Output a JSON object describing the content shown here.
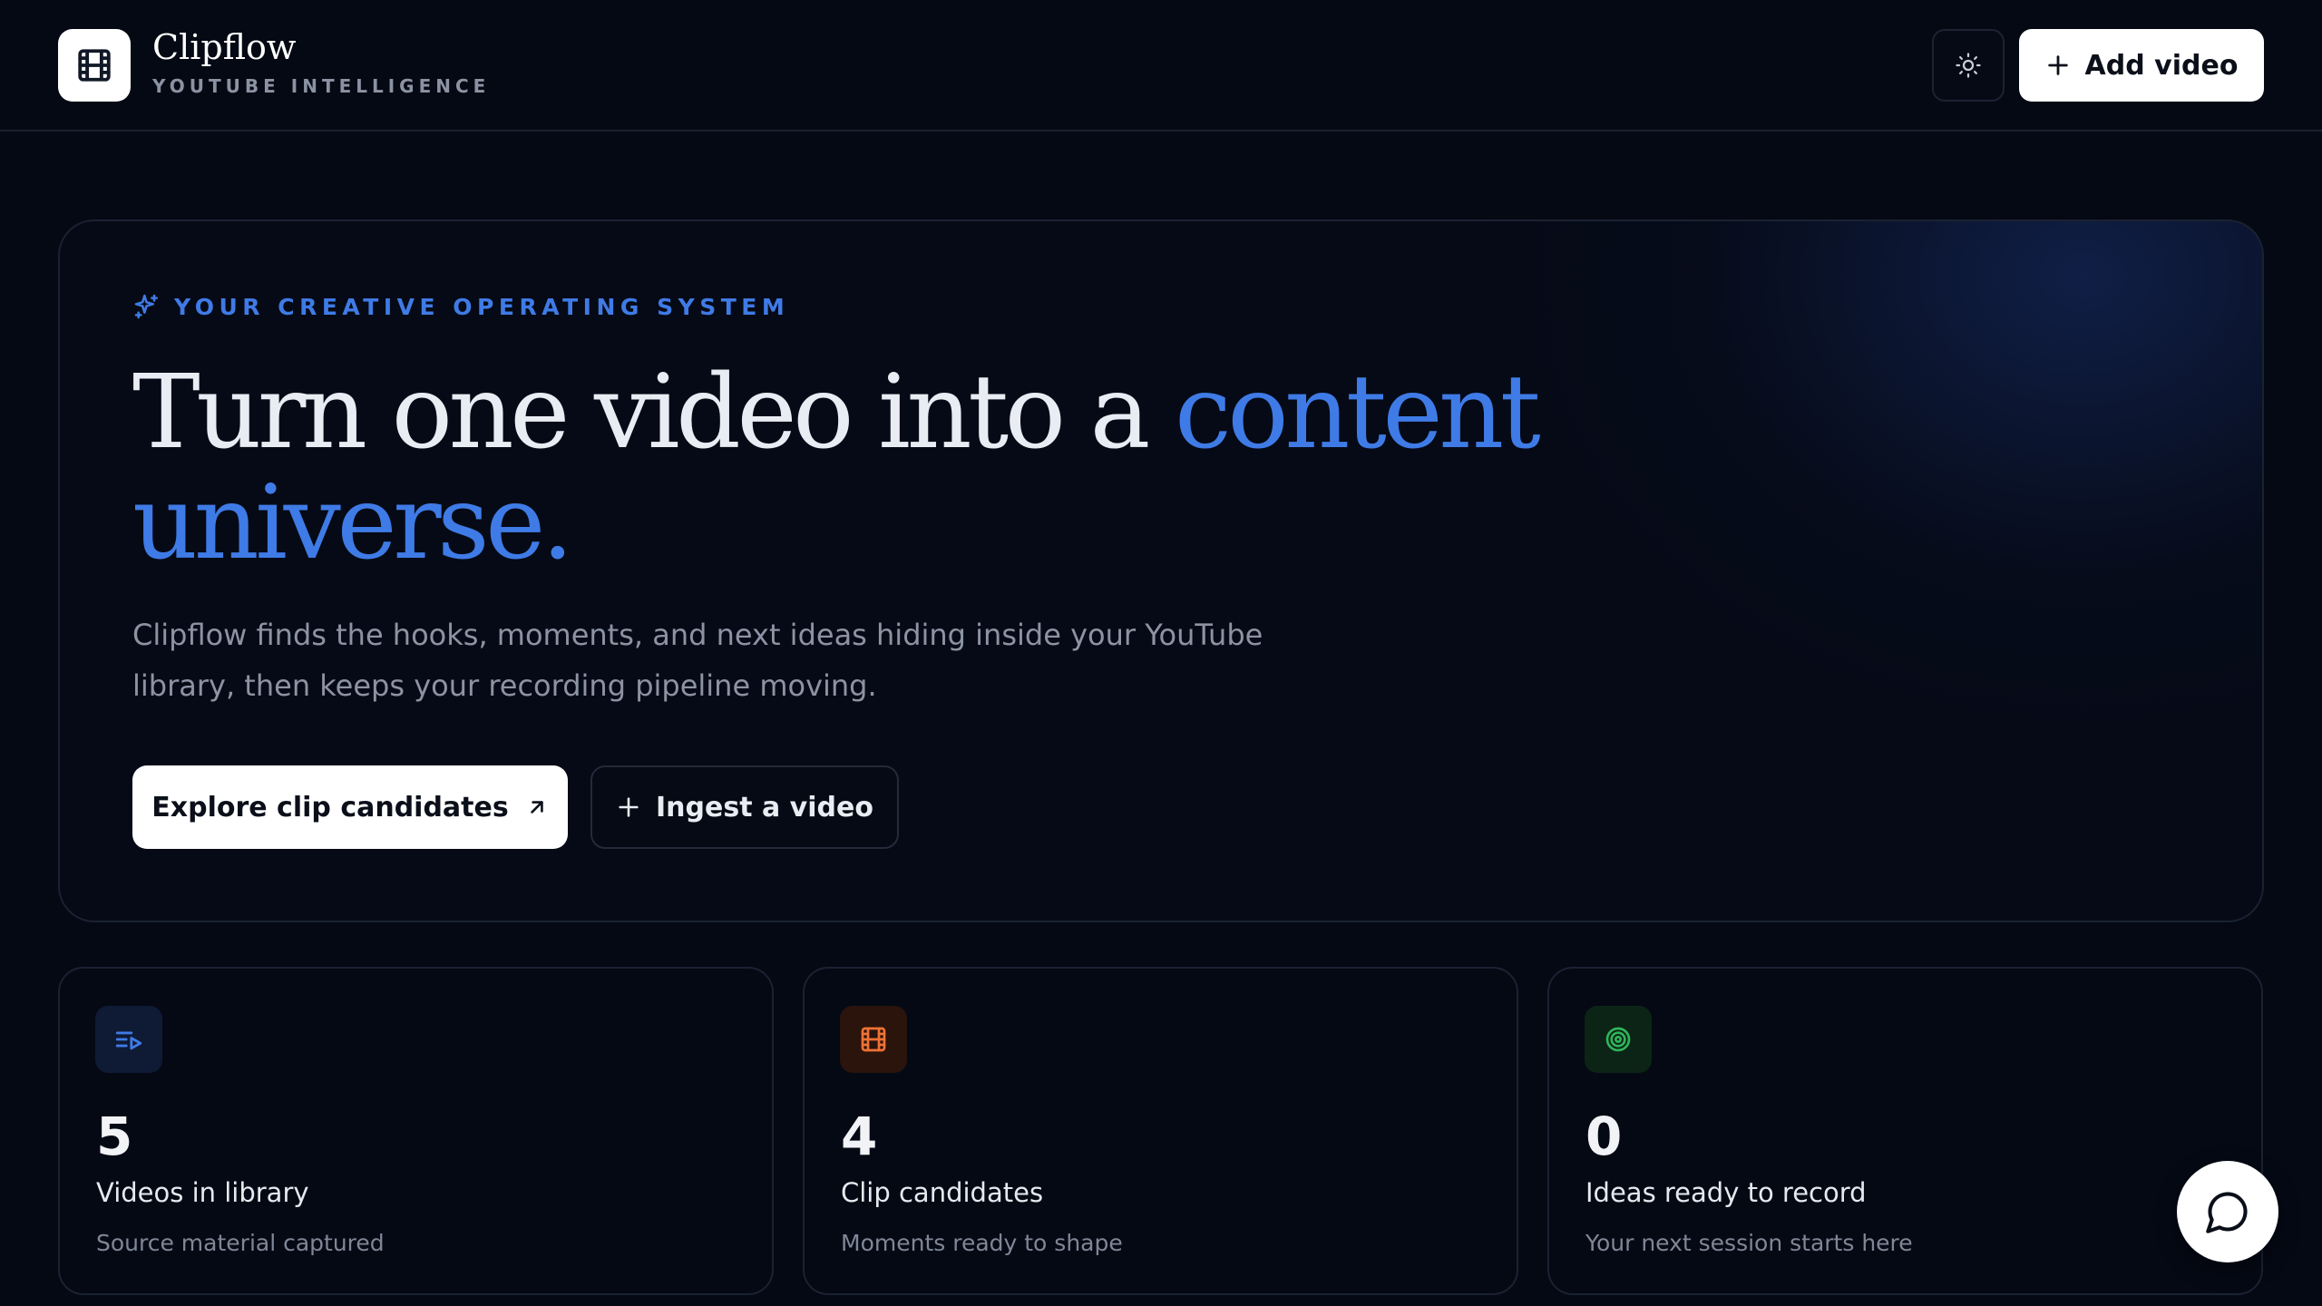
{
  "header": {
    "brand_name": "Clipflow",
    "brand_tagline": "YOUTUBE INTELLIGENCE",
    "logo_icon": "film-icon",
    "theme_toggle_icon": "sun-icon",
    "add_video_label": "Add video"
  },
  "hero": {
    "eyebrow": "YOUR CREATIVE OPERATING SYSTEM",
    "eyebrow_icon": "sparkles-icon",
    "title_plain": "Turn one video into a ",
    "title_accent": "content universe.",
    "description": "Clipflow finds the hooks, moments, and next ideas hiding inside your YouTube library, then keeps your recording pipeline moving.",
    "primary_cta": "Explore clip candidates",
    "secondary_cta": "Ingest a video"
  },
  "stats": [
    {
      "value": "5",
      "label": "Videos in library",
      "sublabel": "Source material captured",
      "icon": "list-video-icon",
      "accent": "#3f7be6"
    },
    {
      "value": "4",
      "label": "Clip candidates",
      "sublabel": "Moments ready to shape",
      "icon": "film-icon",
      "accent": "#f07234"
    },
    {
      "value": "0",
      "label": "Ideas ready to record",
      "sublabel": "Your next session starts here",
      "icon": "target-icon",
      "accent": "#2fb45a"
    }
  ],
  "colors": {
    "background": "#050914",
    "accent_blue": "#3f7be6",
    "accent_orange": "#f07234",
    "accent_green": "#2fb45a"
  },
  "chat_icon": "message-circle-icon"
}
